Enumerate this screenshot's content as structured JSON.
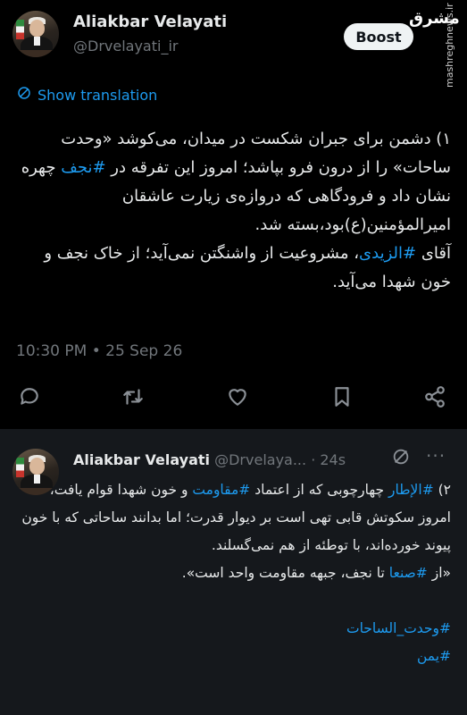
{
  "tweet1": {
    "author_name": "Aliakbar Velayati",
    "handle": "@Drvelayati_ir",
    "boost_label": "Boost",
    "watermark_logo": "مشرق",
    "watermark_site": "mashreghnews.ir",
    "show_translation": "Show translation",
    "text_part1": "۱) دشمن برای جبران شکست در میدان، می‌کوشد «وحدت ساحات» را از درون فرو بپاشد؛ امروز این تفرقه در ",
    "hashtag_najaf": "#نجف",
    "text_part2": " چهره نشان داد و فرودگاهی که دروازه‌ی زیارت عاشقان امیرالمؤمنین(ع)بود،بسته شد.",
    "text_part3": "آقای ",
    "hashtag_zaidi": "#الزیدی",
    "text_part4": "، مشروعیت از واشنگتن نمی‌آید؛ از خاک نجف و خون شهدا می‌آید.",
    "timestamp": "10:30 PM • 25 Sep 26"
  },
  "tweet2": {
    "author_name": "Aliakbar Velayati",
    "handle_time": "@Drvelaya... · 24s",
    "more": "···",
    "text_part1": "۲) ",
    "hashtag_itar": "#الإطار",
    "text_part2": " چهارچوبی که از اعتماد ",
    "hashtag_moghavemat": "#مقاومت",
    "text_part3": " و خون شهدا قوام یافت، امروز سکوتش قابی تهی است بر دیوار قدرت؛ اما بدانند ساحاتی که با خون پیوند خورده‌اند، با توطئه از هم نمی‌گسلند.",
    "text_part4": "«از ",
    "hashtag_sanaa": "#صنعا",
    "text_part5": " تا نجف، جبهه مقاومت واحد است».",
    "hashtag_vahdat": "#وحدت_الساحات",
    "hashtag_yemen": "#یمن"
  },
  "icons": [
    "reply-icon",
    "repost-icon",
    "like-icon",
    "bookmark-icon",
    "share-icon",
    "translate-icon",
    "grok-icon"
  ],
  "colors": {
    "link": "#1d9bf0",
    "muted": "#71767b",
    "text": "#e7e9ea",
    "background": "#000000",
    "card": "#15181c"
  }
}
